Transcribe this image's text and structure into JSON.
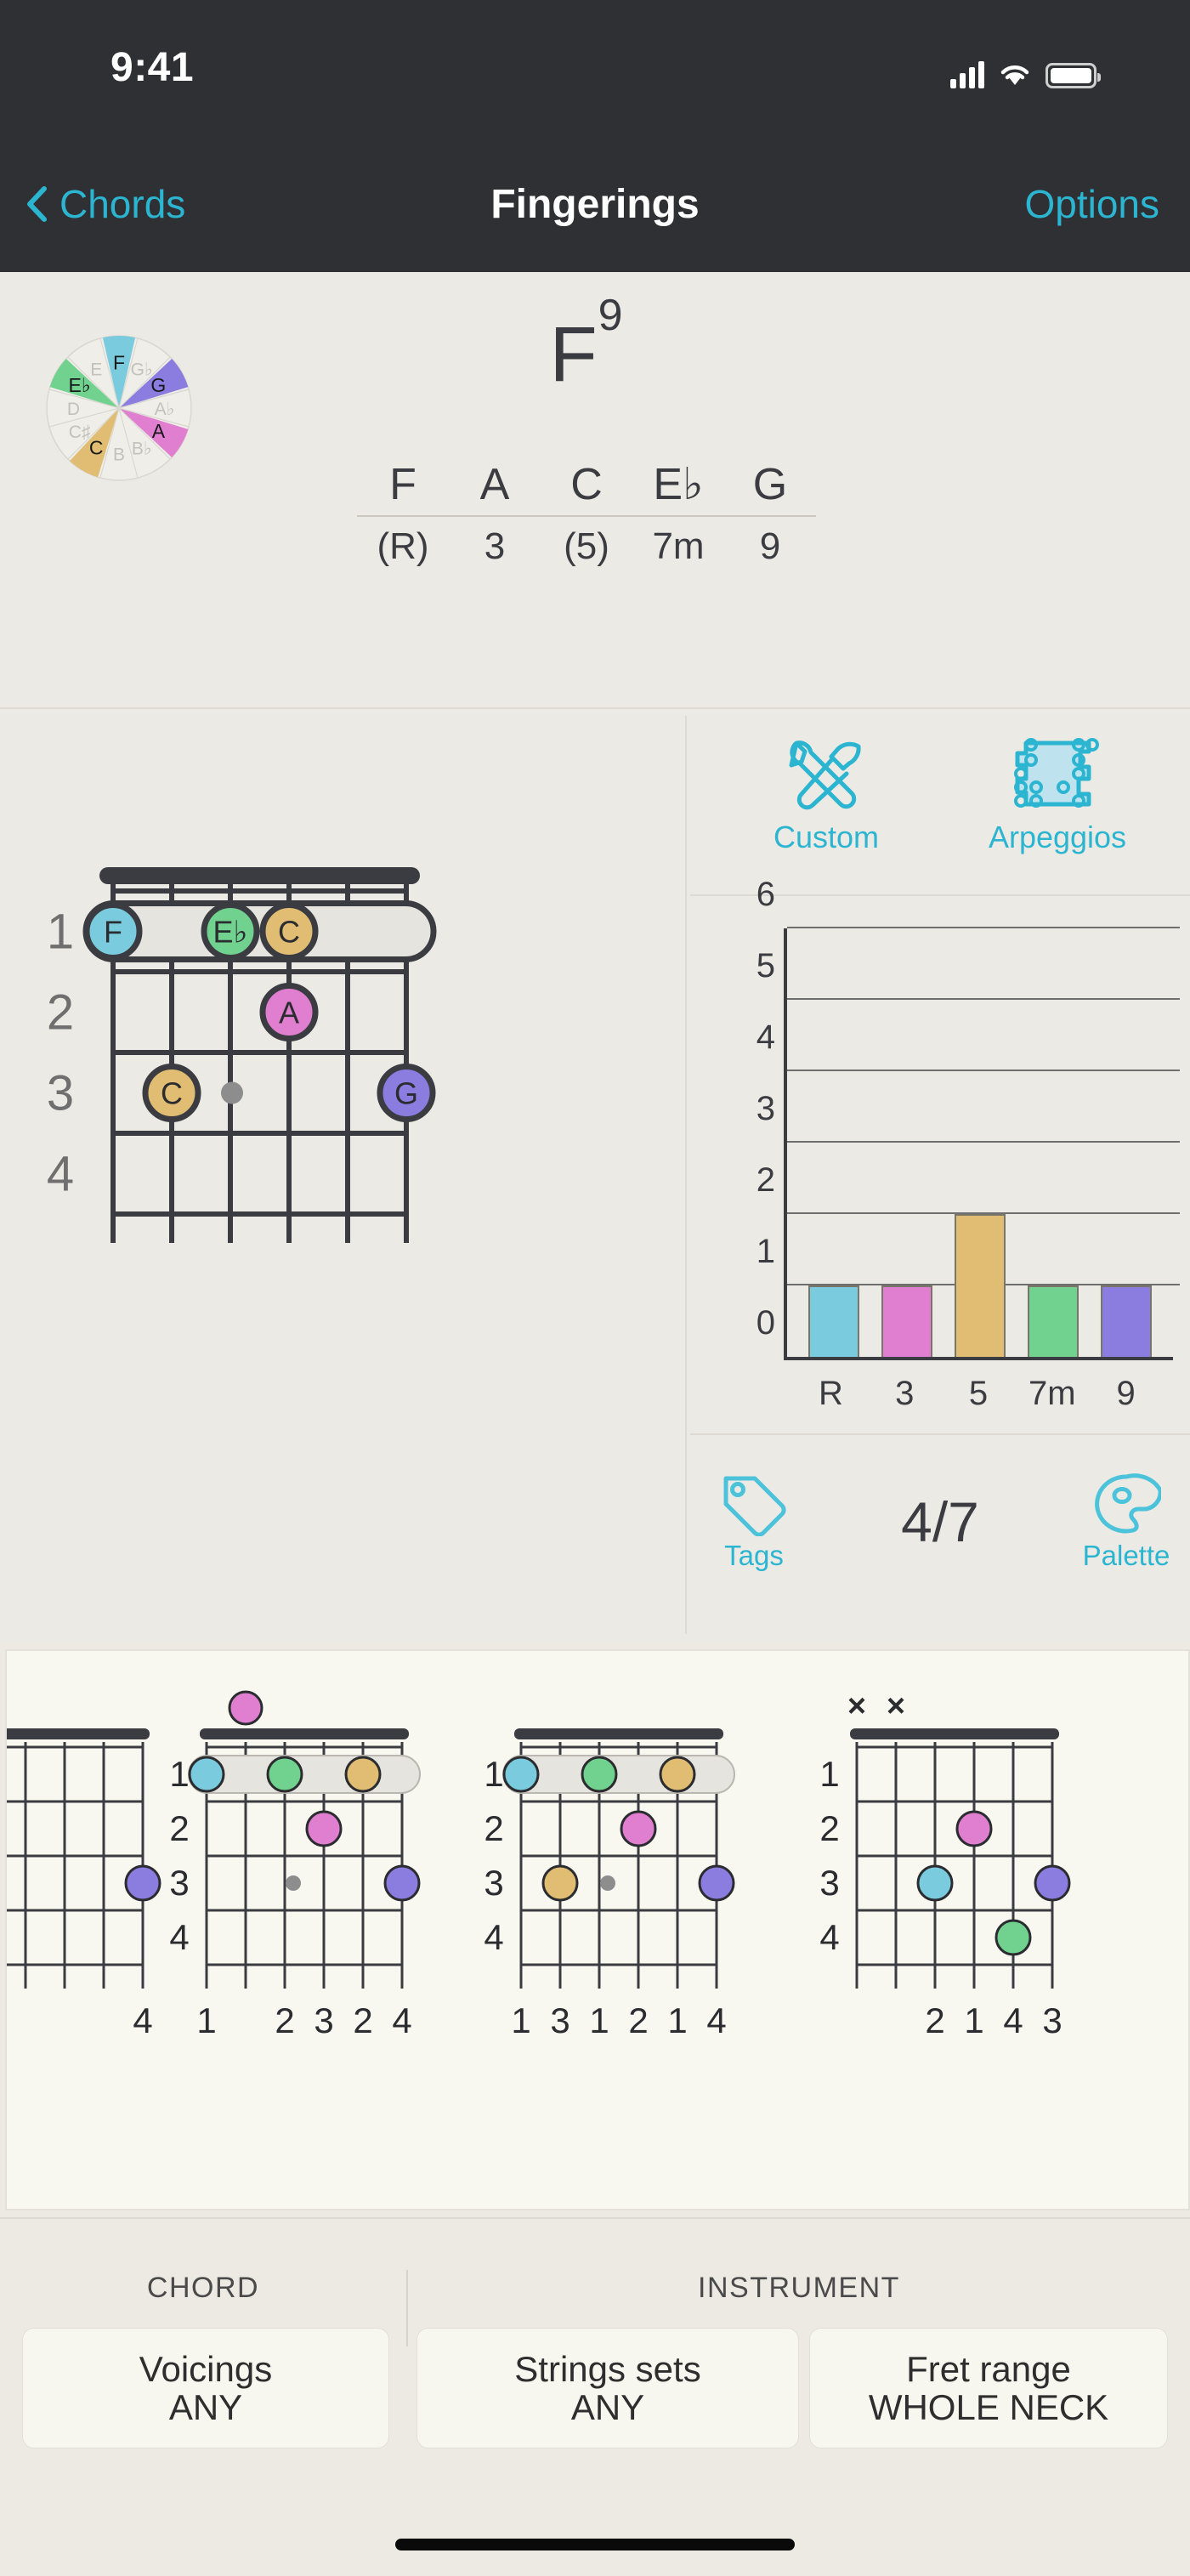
{
  "status_bar": {
    "time": "9:41",
    "signal_icon": "cellular-signal-icon",
    "wifi_icon": "wifi-icon",
    "battery_icon": "battery-icon"
  },
  "nav_bar": {
    "back_label": "Chords",
    "back_icon": "chevron-left-icon",
    "title": "Fingerings",
    "options_label": "Options"
  },
  "chord": {
    "name_root": "F",
    "name_ext": "9",
    "notes": [
      "F",
      "A",
      "C",
      "E♭",
      "G"
    ],
    "degrees": [
      "(R)",
      "3",
      "(5)",
      "7m",
      "9"
    ],
    "wheel": {
      "segments": [
        {
          "label": "C",
          "active": true,
          "color": "#e0bd72",
          "angle": 210
        },
        {
          "label": "C♯",
          "active": false,
          "color": "#efeee9",
          "angle": 240
        },
        {
          "label": "D",
          "active": false,
          "color": "#efeee9",
          "angle": 270
        },
        {
          "label": "E♭",
          "active": true,
          "color": "#71d18e",
          "angle": 300
        },
        {
          "label": "E",
          "active": false,
          "color": "#efeee9",
          "angle": 330
        },
        {
          "label": "F",
          "active": true,
          "color": "#79cbdd",
          "angle": 0
        },
        {
          "label": "G♭",
          "active": false,
          "color": "#efeee9",
          "angle": 30
        },
        {
          "label": "G",
          "active": true,
          "color": "#8b7de0",
          "angle": 60
        },
        {
          "label": "A♭",
          "active": false,
          "color": "#efeee9",
          "angle": 90
        },
        {
          "label": "A",
          "active": true,
          "color": "#e07fd0",
          "angle": 120
        },
        {
          "label": "B♭",
          "active": false,
          "color": "#efeee9",
          "angle": 150
        },
        {
          "label": "B",
          "active": false,
          "color": "#efeee9",
          "angle": 180
        }
      ]
    }
  },
  "tools": {
    "custom": {
      "label": "Custom",
      "icon": "hammer-wrench-icon"
    },
    "arpeggios": {
      "label": "Arpeggios",
      "icon": "arpeggio-grid-icon"
    }
  },
  "footer_tools": {
    "tags": {
      "label": "Tags",
      "icon": "tag-icon"
    },
    "counter": "4/7",
    "palette": {
      "label": "Palette",
      "icon": "palette-icon"
    }
  },
  "chart_data": {
    "type": "bar",
    "title": "",
    "xlabel": "",
    "ylabel": "",
    "categories": [
      "R",
      "3",
      "5",
      "7m",
      "9"
    ],
    "values": [
      1,
      1,
      2,
      1,
      1
    ],
    "colors": [
      "#79cbdd",
      "#e07fd0",
      "#e0bd72",
      "#71d18e",
      "#8b7de0"
    ],
    "ylim": [
      0,
      6
    ],
    "yticks": [
      0,
      1,
      2,
      3,
      4,
      5,
      6
    ],
    "grid": true,
    "legend": "none"
  },
  "main_diagram": {
    "fret_labels": [
      "1",
      "2",
      "3",
      "4"
    ],
    "strings": 6,
    "nut": true,
    "barre": {
      "fret": 1,
      "from_string": 1,
      "to_string": 6
    },
    "dots": [
      {
        "string": 1,
        "fret": 1,
        "label": "F",
        "color": "#79cbdd"
      },
      {
        "string": 3,
        "fret": 1,
        "label": "E♭",
        "color": "#71d18e"
      },
      {
        "string": 4,
        "fret": 1,
        "label": "C",
        "color": "#e0bd72"
      },
      {
        "string": 4,
        "fret": 2,
        "label": "A",
        "color": "#e07fd0"
      },
      {
        "string": 2,
        "fret": 3,
        "label": "C",
        "color": "#e0bd72"
      },
      {
        "string": 6,
        "fret": 3,
        "label": "G",
        "color": "#8b7de0"
      }
    ],
    "mute_dot": {
      "string": 3,
      "fret": 3
    }
  },
  "carousel": [
    {
      "fret_labels": [
        "1",
        "2",
        "3",
        "4"
      ],
      "fingers": [
        "",
        "",
        "",
        "",
        "",
        "4"
      ],
      "open_dot": null,
      "dots": [
        {
          "string": 6,
          "fret": 3,
          "color": "#8b7de0"
        }
      ],
      "partial": true
    },
    {
      "fret_labels": [
        "1",
        "2",
        "3",
        "4"
      ],
      "fingers": [
        "1",
        "",
        "2",
        "3",
        "2",
        "4"
      ],
      "open_dot": {
        "string": 2,
        "color": "#e07fd0"
      },
      "barre": {
        "fret": 1,
        "from_string": 1,
        "to_string": 6
      },
      "dots": [
        {
          "string": 1,
          "fret": 1,
          "color": "#79cbdd"
        },
        {
          "string": 3,
          "fret": 1,
          "color": "#71d18e"
        },
        {
          "string": 5,
          "fret": 1,
          "color": "#e0bd72"
        },
        {
          "string": 4,
          "fret": 2,
          "color": "#e07fd0"
        },
        {
          "string": 6,
          "fret": 3,
          "color": "#8b7de0"
        }
      ],
      "mute_dot": {
        "string": 3,
        "fret": 3
      }
    },
    {
      "fret_labels": [
        "1",
        "2",
        "3",
        "4"
      ],
      "fingers": [
        "1",
        "3",
        "1",
        "2",
        "1",
        "4"
      ],
      "barre": {
        "fret": 1,
        "from_string": 1,
        "to_string": 6
      },
      "dots": [
        {
          "string": 1,
          "fret": 1,
          "color": "#79cbdd"
        },
        {
          "string": 3,
          "fret": 1,
          "color": "#71d18e"
        },
        {
          "string": 5,
          "fret": 1,
          "color": "#e0bd72"
        },
        {
          "string": 2,
          "fret": 3,
          "color": "#e0bd72"
        },
        {
          "string": 4,
          "fret": 2,
          "color": "#e07fd0"
        },
        {
          "string": 6,
          "fret": 3,
          "color": "#8b7de0"
        }
      ],
      "mute_dot": {
        "string": 3,
        "fret": 3
      }
    },
    {
      "fret_labels": [
        "1",
        "2",
        "3",
        "4"
      ],
      "fingers": [
        "",
        "",
        "2",
        "1",
        "4",
        "3"
      ],
      "muted_strings": [
        "x",
        "x"
      ],
      "dots": [
        {
          "string": 3,
          "fret": 3,
          "color": "#79cbdd"
        },
        {
          "string": 4,
          "fret": 2,
          "color": "#e07fd0"
        },
        {
          "string": 5,
          "fret": 4,
          "color": "#71d18e"
        },
        {
          "string": 6,
          "fret": 3,
          "color": "#8b7de0"
        }
      ],
      "mute_dot": {
        "string": 3,
        "fret": 3
      }
    }
  ],
  "filters": {
    "chord_group_label": "CHORD",
    "instrument_group_label": "INSTRUMENT",
    "buttons": [
      {
        "title": "Voicings",
        "value": "ANY"
      },
      {
        "title": "Strings sets",
        "value": "ANY"
      },
      {
        "title": "Fret range",
        "value": "WHOLE NECK"
      }
    ]
  }
}
